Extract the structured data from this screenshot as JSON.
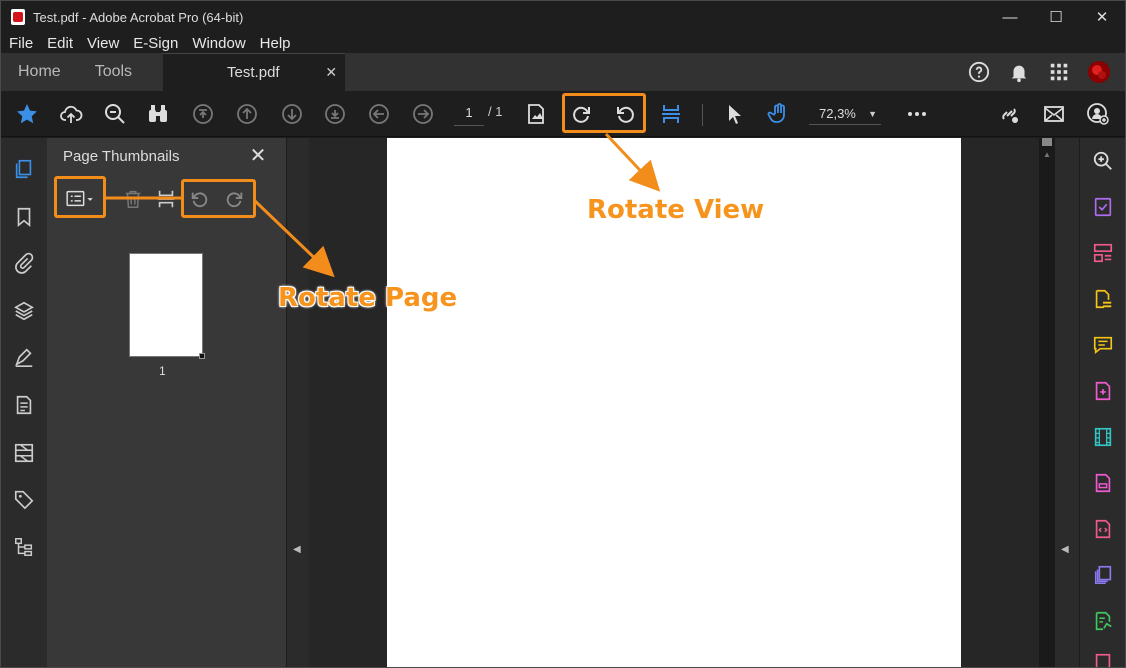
{
  "window": {
    "title": "Test.pdf - Adobe Acrobat Pro (64-bit)",
    "minimize": "—",
    "maximize": "☐",
    "close": "✕"
  },
  "menu": [
    "File",
    "Edit",
    "View",
    "E-Sign",
    "Window",
    "Help"
  ],
  "tabs": {
    "home": "Home",
    "tools": "Tools",
    "file": "Test.pdf",
    "file_close": "✕"
  },
  "toolbar": {
    "current_page": "1",
    "page_separator": "/",
    "total_pages": "1",
    "zoom": "72,3%",
    "zoom_caret": "▼"
  },
  "thumbnails_panel": {
    "title": "Page Thumbnails",
    "close": "✕",
    "page_label": "1"
  },
  "annotations": {
    "rotate_view": "Rotate View",
    "rotate_page": "Rotate Page"
  },
  "collapse": {
    "left_arrow": "◀",
    "right_arrow": "◀",
    "scroll_up": "▲"
  },
  "colors": {
    "accent_blue": "#3b8fe6",
    "annotation_orange": "#f28c1b",
    "right_rail": [
      "#5aa9ff",
      "#b06cf0",
      "#f05a8c",
      "#f5c518",
      "#f5c518",
      "#f05ad0",
      "#33c6c6",
      "#f05ad0",
      "#f05ad0",
      "#8a7af0",
      "#40c860",
      "#f05a8c"
    ]
  }
}
